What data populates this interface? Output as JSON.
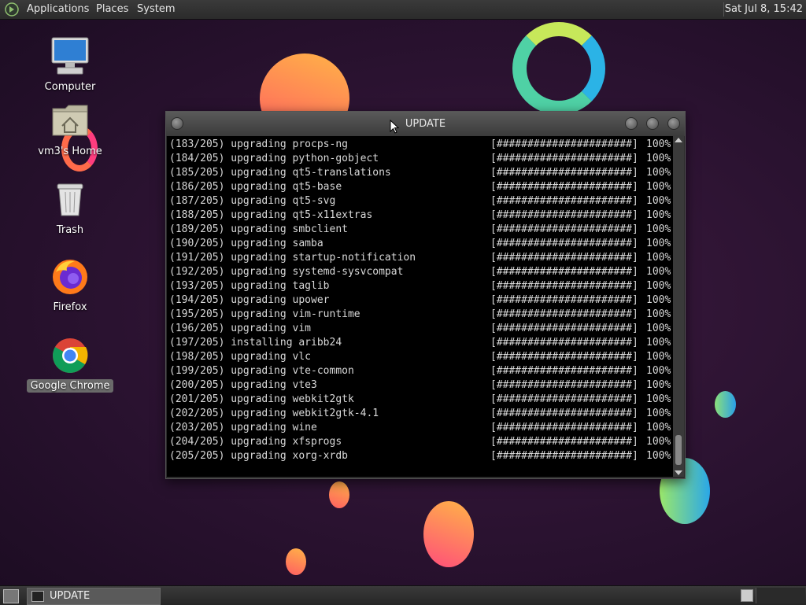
{
  "top_panel": {
    "menus": [
      "Applications",
      "Places",
      "System"
    ],
    "clock": "Sat Jul  8, 15:42"
  },
  "desktop_icons": [
    {
      "label": "Computer",
      "icon": "computer-icon"
    },
    {
      "label": "vm3's Home",
      "icon": "home-folder-icon"
    },
    {
      "label": "Trash",
      "icon": "trash-icon"
    },
    {
      "label": "Firefox",
      "icon": "firefox-icon"
    },
    {
      "label": "Google Chrome",
      "icon": "chrome-icon"
    }
  ],
  "window": {
    "title": "UPDATE",
    "lines": [
      {
        "msg": "(183/205) upgrading procps-ng",
        "bar": "[######################]",
        "pct": "100%"
      },
      {
        "msg": "(184/205) upgrading python-gobject",
        "bar": "[######################]",
        "pct": "100%"
      },
      {
        "msg": "(185/205) upgrading qt5-translations",
        "bar": "[######################]",
        "pct": "100%"
      },
      {
        "msg": "(186/205) upgrading qt5-base",
        "bar": "[######################]",
        "pct": "100%"
      },
      {
        "msg": "(187/205) upgrading qt5-svg",
        "bar": "[######################]",
        "pct": "100%"
      },
      {
        "msg": "(188/205) upgrading qt5-x11extras",
        "bar": "[######################]",
        "pct": "100%"
      },
      {
        "msg": "(189/205) upgrading smbclient",
        "bar": "[######################]",
        "pct": "100%"
      },
      {
        "msg": "(190/205) upgrading samba",
        "bar": "[######################]",
        "pct": "100%"
      },
      {
        "msg": "(191/205) upgrading startup-notification",
        "bar": "[######################]",
        "pct": "100%"
      },
      {
        "msg": "(192/205) upgrading systemd-sysvcompat",
        "bar": "[######################]",
        "pct": "100%"
      },
      {
        "msg": "(193/205) upgrading taglib",
        "bar": "[######################]",
        "pct": "100%"
      },
      {
        "msg": "(194/205) upgrading upower",
        "bar": "[######################]",
        "pct": "100%"
      },
      {
        "msg": "(195/205) upgrading vim-runtime",
        "bar": "[######################]",
        "pct": "100%"
      },
      {
        "msg": "(196/205) upgrading vim",
        "bar": "[######################]",
        "pct": "100%"
      },
      {
        "msg": "(197/205) installing aribb24",
        "bar": "[######################]",
        "pct": "100%"
      },
      {
        "msg": "(198/205) upgrading vlc",
        "bar": "[######################]",
        "pct": "100%"
      },
      {
        "msg": "(199/205) upgrading vte-common",
        "bar": "[######################]",
        "pct": "100%"
      },
      {
        "msg": "(200/205) upgrading vte3",
        "bar": "[######################]",
        "pct": "100%"
      },
      {
        "msg": "(201/205) upgrading webkit2gtk",
        "bar": "[######################]",
        "pct": "100%"
      },
      {
        "msg": "(202/205) upgrading webkit2gtk-4.1",
        "bar": "[######################]",
        "pct": "100%"
      },
      {
        "msg": "(203/205) upgrading wine",
        "bar": "[######################]",
        "pct": "100%"
      },
      {
        "msg": "(204/205) upgrading xfsprogs",
        "bar": "[######################]",
        "pct": "100%"
      },
      {
        "msg": "(205/205) upgrading xorg-xrdb",
        "bar": "[######################]",
        "pct": "100%"
      }
    ]
  },
  "taskbar": {
    "task_label": "UPDATE"
  }
}
